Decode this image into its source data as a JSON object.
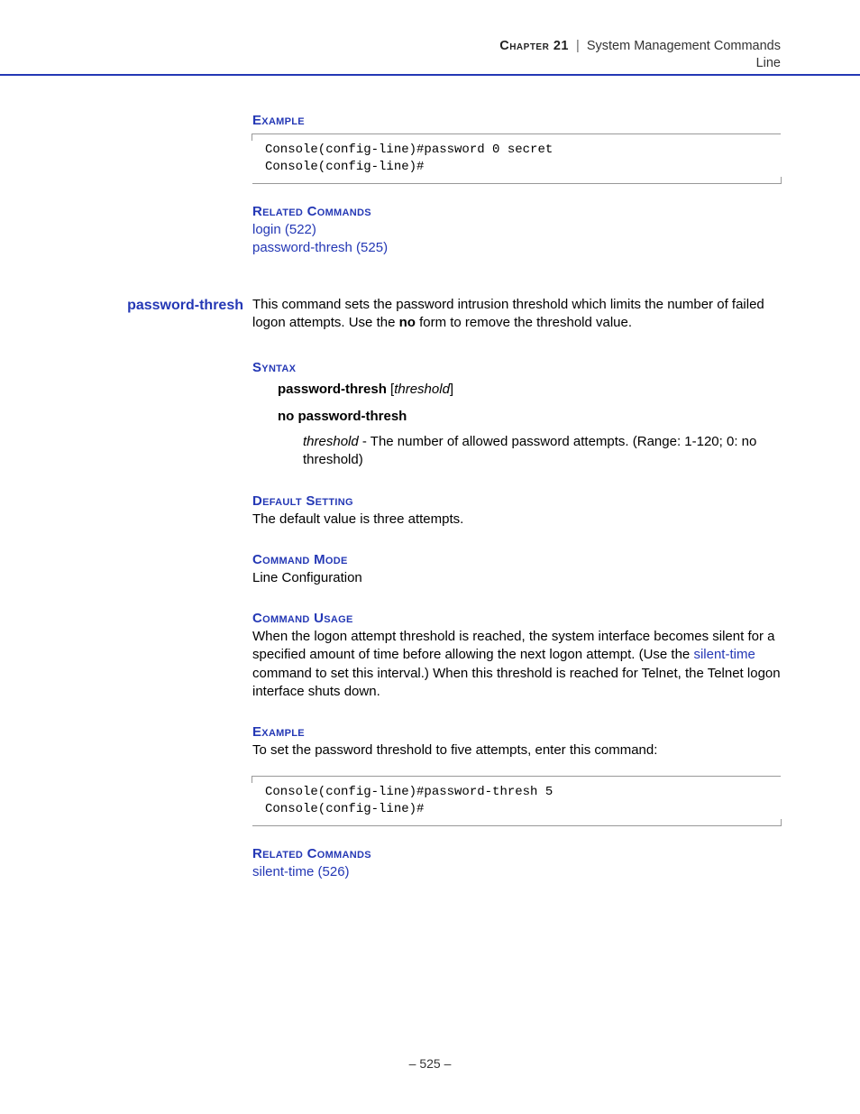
{
  "header": {
    "chapter_label": "Chapter 21",
    "separator": "|",
    "chapter_title": "System Management Commands",
    "subtitle": "Line"
  },
  "top_section": {
    "example_label": "Example",
    "example_code": "Console(config-line)#password 0 secret\nConsole(config-line)#",
    "related_label": "Related Commands",
    "related_links": {
      "login": "login (522)",
      "password_thresh": "password-thresh (525)"
    }
  },
  "command": {
    "name": "password-thresh",
    "description_pre": "This command sets the password intrusion threshold which limits the number of failed logon attempts. Use the ",
    "description_bold": "no",
    "description_post": " form to remove the threshold value.",
    "syntax": {
      "label": "Syntax",
      "line1_cmd": "password-thresh",
      "line1_arg": "threshold",
      "line2_cmd": "no password-thresh",
      "param_name": "threshold",
      "param_desc": " - The number of allowed password attempts. (Range: 1-120; 0: no threshold)"
    },
    "default": {
      "label": "Default Setting",
      "text": "The default value is three attempts."
    },
    "mode": {
      "label": "Command Mode",
      "text": "Line Configuration"
    },
    "usage": {
      "label": "Command Usage",
      "text_pre": "When the logon attempt threshold is reached, the system interface becomes silent for a specified amount of time before allowing the next logon attempt. (Use the ",
      "link": "silent-time",
      "text_post": " command to set this interval.) When this threshold is reached for Telnet, the Telnet logon interface shuts down."
    },
    "example": {
      "label": "Example",
      "intro": "To set the password threshold to five attempts, enter this command:",
      "code": "Console(config-line)#password-thresh 5\nConsole(config-line)#"
    },
    "related": {
      "label": "Related Commands",
      "link": "silent-time (526)"
    }
  },
  "footer": {
    "page": "– 525 –"
  }
}
